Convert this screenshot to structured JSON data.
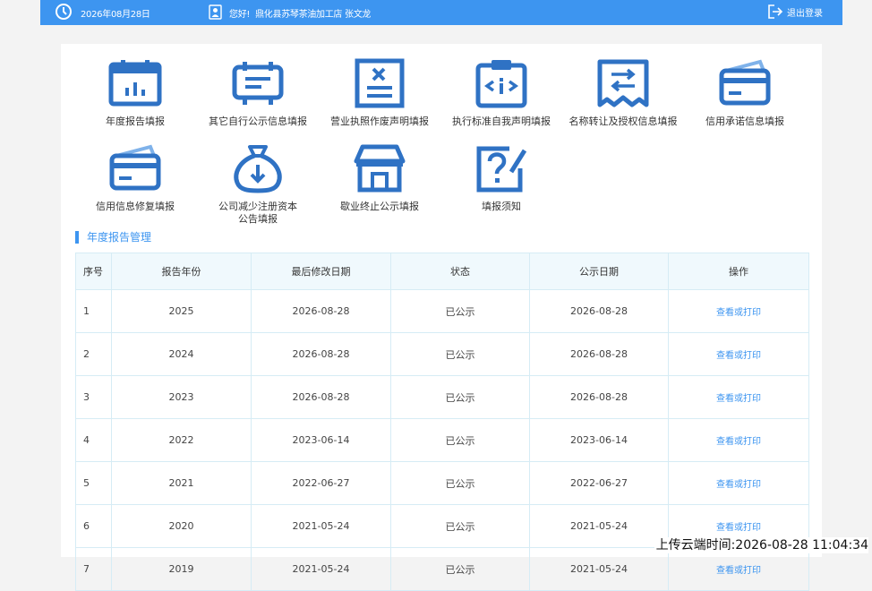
{
  "header": {
    "date": "2026年08月28日",
    "greeting": "您好!",
    "company_user": "鼎化县苏琴茶油加工店 张文龙",
    "logout_label": "退出登录",
    "accent_color": "#3d95f0"
  },
  "tiles": [
    {
      "label": "年度报告填报",
      "icon": "calendar-chart-icon"
    },
    {
      "label": "其它自行公示信息填报",
      "icon": "message-board-icon"
    },
    {
      "label": "营业执照作废声明填报",
      "icon": "cancelled-document-icon"
    },
    {
      "label": "执行标准自我声明填报",
      "icon": "clipboard-code-icon"
    },
    {
      "label": "名称转让及授权信息填报",
      "icon": "transfer-receipt-icon"
    },
    {
      "label": "信用承诺信息填报",
      "icon": "credit-card-icon"
    },
    {
      "label": "信用信息修复填报",
      "icon": "credit-card-repair-icon"
    },
    {
      "label": "公司减少注册资本",
      "label2": "公告填报",
      "icon": "money-bag-icon"
    },
    {
      "label": "歇业终止公示填报",
      "icon": "store-icon"
    },
    {
      "label": "填报须知",
      "icon": "question-edit-icon"
    }
  ],
  "section": {
    "title": "年度报告管理"
  },
  "table": {
    "headers": [
      "序号",
      "报告年份",
      "最后修改日期",
      "状态",
      "公示日期",
      "操作"
    ],
    "rows": [
      {
        "no": "1",
        "year": "2025",
        "modified": "2026-08-28",
        "status": "已公示",
        "published": "2026-08-28",
        "action": "查看或打印"
      },
      {
        "no": "2",
        "year": "2024",
        "modified": "2026-08-28",
        "status": "已公示",
        "published": "2026-08-28",
        "action": "查看或打印"
      },
      {
        "no": "3",
        "year": "2023",
        "modified": "2026-08-28",
        "status": "已公示",
        "published": "2026-08-28",
        "action": "查看或打印"
      },
      {
        "no": "4",
        "year": "2022",
        "modified": "2023-06-14",
        "status": "已公示",
        "published": "2023-06-14",
        "action": "查看或打印"
      },
      {
        "no": "5",
        "year": "2021",
        "modified": "2022-06-27",
        "status": "已公示",
        "published": "2022-06-27",
        "action": "查看或打印"
      },
      {
        "no": "6",
        "year": "2020",
        "modified": "2021-05-24",
        "status": "已公示",
        "published": "2021-05-24",
        "action": "查看或打印"
      },
      {
        "no": "7",
        "year": "2019",
        "modified": "2021-05-24",
        "status": "已公示",
        "published": "2021-05-24",
        "action": "查看或打印"
      }
    ]
  },
  "watermark": {
    "upload_time": "上传云端时间:2026-08-28 11:04:34"
  }
}
